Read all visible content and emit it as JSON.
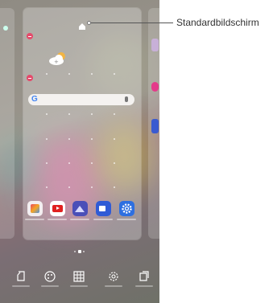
{
  "callout": {
    "label": "Standardbildschirm"
  },
  "icons": {
    "weather": "weather-cloud-icon",
    "search_logo": "google-g-icon",
    "mic": "mic-icon",
    "home": "home-icon",
    "apps": [
      "gallery-icon",
      "youtube-icon",
      "photos-icon",
      "video-icon",
      "settings-icon"
    ],
    "bottom": [
      "wallpaper-icon",
      "themes-icon",
      "apps-grid-icon",
      "settings-icon",
      "widgets-icon"
    ]
  },
  "colors": {
    "accent_remove": "#e44a6b",
    "youtube": "#e02020",
    "photos": "#4a4fb8",
    "video": "#2f5bd6",
    "settings": "#2d6fe0"
  }
}
